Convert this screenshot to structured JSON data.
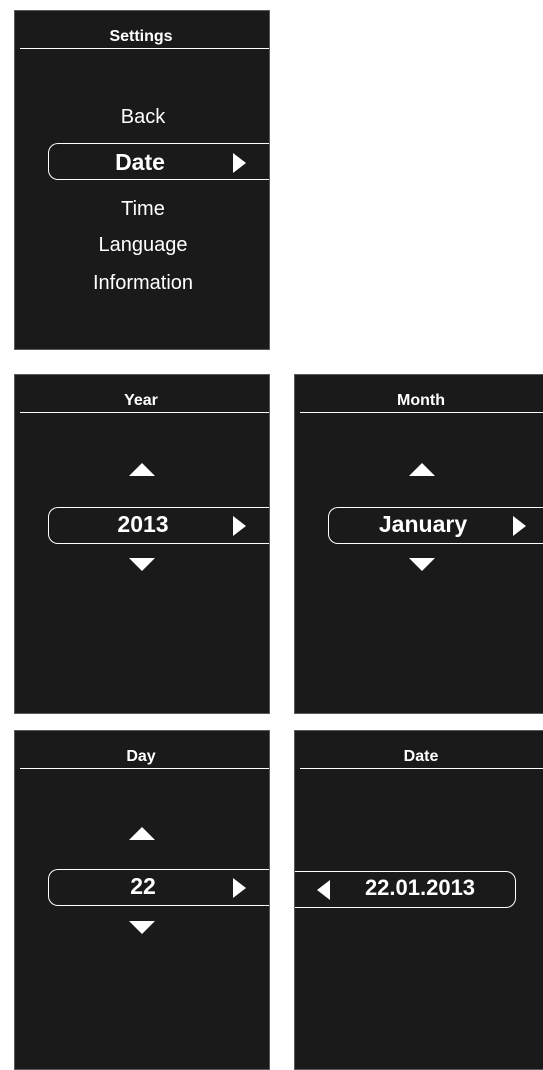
{
  "settings": {
    "title": "Settings",
    "items": [
      "Back",
      "Date",
      "Time",
      "Language",
      "Information"
    ],
    "selected": "Date"
  },
  "year": {
    "title": "Year",
    "value": "2013"
  },
  "month": {
    "title": "Month",
    "value": "January"
  },
  "day": {
    "title": "Day",
    "value": "22"
  },
  "date": {
    "title": "Date",
    "value": "22.01.2013"
  },
  "icons": {
    "arrow_right": "arrow-right-icon",
    "arrow_left": "arrow-left-icon",
    "arrow_up": "arrow-up-icon",
    "arrow_down": "arrow-down-icon"
  },
  "colors": {
    "screen_bg": "#1a1a1a",
    "text": "#ffffff",
    "page_bg": "#ffffff"
  }
}
